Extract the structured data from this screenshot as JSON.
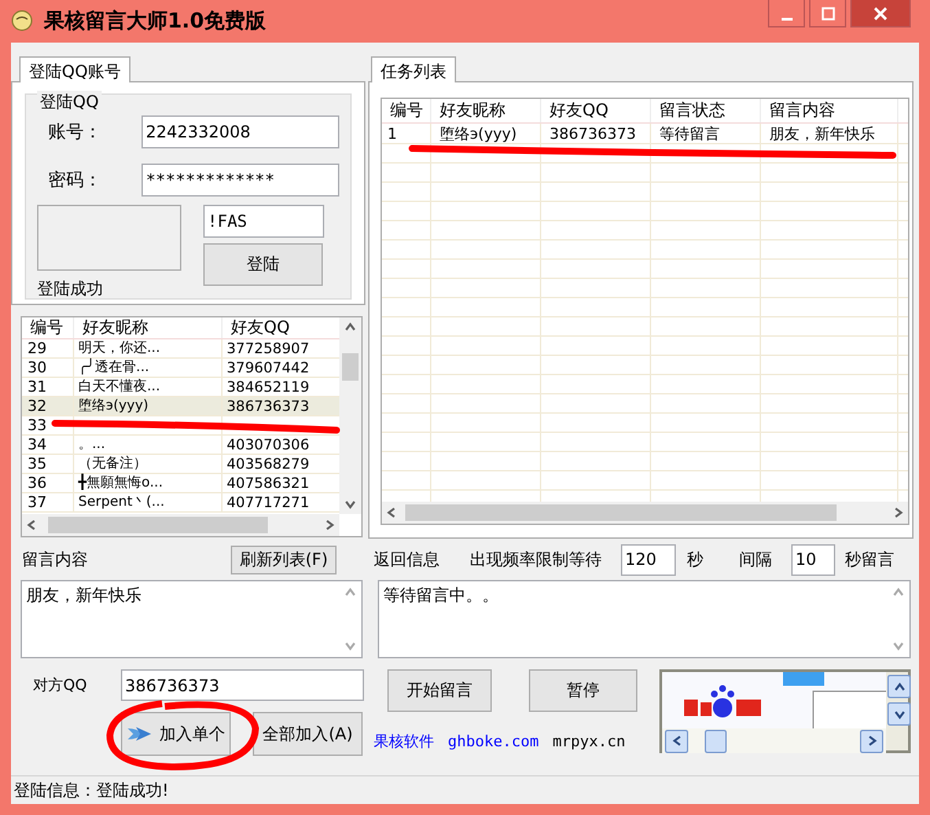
{
  "window": {
    "title": "果核留言大师1.0免费版"
  },
  "login_tab": {
    "label": "登陆QQ账号",
    "selected": true
  },
  "login_group": {
    "title": "登陆QQ",
    "account_label": "账号：",
    "account": "2242332008",
    "password_label": "密码：",
    "password": "*************",
    "captcha": "!FAS",
    "status": "登陆成功",
    "login_button": "登陆"
  },
  "friends": {
    "columns": [
      "编号",
      "好友昵称",
      "好友QQ"
    ],
    "rows": [
      {
        "id": "29",
        "nickname": "明天，你还...",
        "qq": "377258907",
        "selected": false
      },
      {
        "id": "30",
        "nickname": "╭╯透在骨...",
        "qq": "379607442",
        "selected": false
      },
      {
        "id": "31",
        "nickname": "白天不懂夜...",
        "qq": "384652119",
        "selected": false
      },
      {
        "id": "32",
        "nickname": "堕络э(yyy)",
        "qq": "386736373",
        "selected": true
      },
      {
        "id": "33",
        "selected": false
      },
      {
        "id": "34",
        "nickname": "。...",
        "qq": "403070306",
        "selected": false
      },
      {
        "id": "35",
        "nickname": "（无备注）",
        "qq": "403568279",
        "selected": false
      },
      {
        "id": "36",
        "nickname": "╋無願無悔o...",
        "qq": "407586321",
        "selected": false
      },
      {
        "id": "37",
        "nickname": "Serpent丶(...",
        "qq": "407717271",
        "selected": false
      }
    ]
  },
  "task_tab": {
    "label": "任务列表",
    "selected": true
  },
  "tasks": {
    "columns": [
      "编号",
      "好友昵称",
      "好友QQ",
      "留言状态",
      "留言内容"
    ],
    "rows": [
      {
        "cells": [
          "1",
          "堕络э(yyy)",
          "386736373",
          "等待留言",
          "朋友，新年快乐"
        ]
      }
    ]
  },
  "message": {
    "label": "留言内容",
    "value": "朋友，新年快乐"
  },
  "refresh_button": "刷新列表(F)",
  "return_info": {
    "label": "返回信息",
    "value": "等待留言中。。"
  },
  "rate": {
    "label": "出现频率限制等待",
    "wait": "120",
    "unit": "秒",
    "interval_label": "间隔",
    "interval": "10",
    "interval_unit": "秒留言"
  },
  "target": {
    "label": "对方QQ",
    "value": "386736373"
  },
  "add_one_button": "加入单个",
  "add_all_button": "全部加入(A)",
  "start_button": "开始留言",
  "pause_button": "暂停",
  "links": [
    {
      "label": "果核软件",
      "color": "#0000ff"
    },
    {
      "label": "ghboke.com",
      "color": "#0000ff"
    },
    {
      "label": "mrpyx.cn",
      "color": "#000000"
    }
  ],
  "status_bar": "登陆信息：登陆成功!"
}
